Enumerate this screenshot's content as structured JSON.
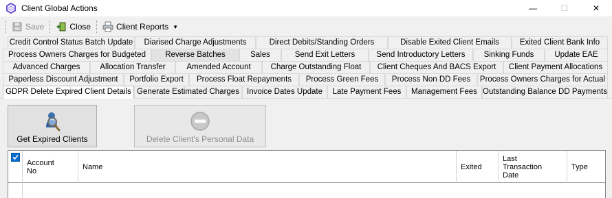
{
  "window": {
    "title": "Client Global Actions",
    "controls": {
      "minimize": "—",
      "maximize": "☐",
      "close": "✕"
    }
  },
  "toolbar": {
    "save_label": "Save",
    "close_label": "Close",
    "reports_label": "Client Reports"
  },
  "tabs": {
    "row1": [
      "Credit Control Status Batch Update",
      "Diarised Charge Adjustments",
      "Direct Debits/Standing Orders",
      "Disable Exited Client Emails",
      "Exited Client Bank Info"
    ],
    "row2": [
      "Process Owners Charges for Budgeted",
      "Reverse  Batches",
      "Sales",
      "Send Exit Letters",
      "Send Introductory Letters",
      "Sinking Funds",
      "Update EAE"
    ],
    "row3": [
      "Advanced Charges",
      "Allocation Transfer",
      "Amended Account",
      "Charge Outstanding Float",
      "Client Cheques And BACS Export",
      "Client Payment Allocations"
    ],
    "row4": [
      "Paperless Discount Adjustment",
      "Portfolio Export",
      "Process Float Repayments",
      "Process Green Fees",
      "Process Non DD Fees",
      "Process Owners Charges for Actual"
    ],
    "row5": [
      "GDPR Delete Expired Client Details",
      "Generate Estimated Charges",
      "Invoice Dates Update",
      "Late Payment Fees",
      "Management Fees",
      "Outstanding Balance DD Payments"
    ],
    "selected": "GDPR Delete Expired Client Details"
  },
  "actions": {
    "get_expired_label": "Get Expired Clients",
    "delete_personal_label": "Delete Client's Personal Data"
  },
  "grid": {
    "columns": [
      "Account\nNo",
      "Name",
      "Exited",
      "Last\nTransaction\nDate",
      "Type"
    ],
    "select_all_checked": true
  },
  "colors": {
    "accent": "#0a6ed1",
    "window_bg": "#f0f0f0"
  }
}
